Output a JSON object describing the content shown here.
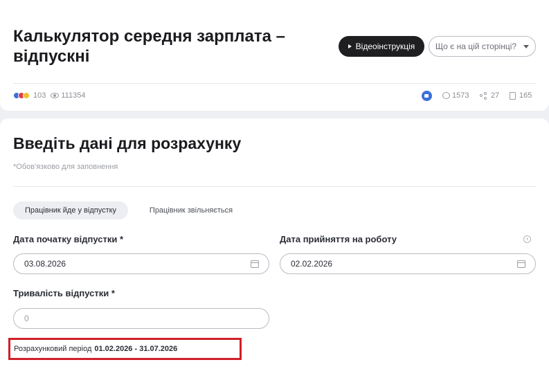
{
  "header": {
    "title": "Калькулятор середня зарплата – відпускні",
    "video_button": "Відеоінструкція",
    "page_menu_button": "Що є на цій сторінці?"
  },
  "stats": {
    "reactions_count": "103",
    "views": "111354",
    "comments": "1573",
    "shares": "27",
    "saves": "165"
  },
  "form": {
    "heading": "Введіть дані для розрахунку",
    "required_note": "*Обов'язково для заповнення",
    "tabs": [
      {
        "label": "Працівник йде у відпустку",
        "active": true
      },
      {
        "label": "Працівник звільняється",
        "active": false
      }
    ],
    "fields": {
      "vacation_start": {
        "label": "Дата початку відпустки *",
        "value": "03.08.2026"
      },
      "hire_date": {
        "label": "Дата прийняття на роботу",
        "value": "02.02.2026"
      },
      "vacation_length": {
        "label": "Тривалість відпустки *",
        "placeholder": "0"
      }
    },
    "period": {
      "label": "Розрахунковий період",
      "value": "01.02.2026 - 31.07.2026"
    }
  },
  "colors": {
    "accent_dark": "#1f1f22",
    "highlight_border": "#cf1f28",
    "like_blue": "#3d6fd8"
  },
  "icons": [
    "play-icon",
    "chevron-down-icon",
    "eye-icon",
    "like-icon",
    "comment-icon",
    "share-icon",
    "bookmark-icon",
    "info-icon",
    "calendar-icon"
  ]
}
